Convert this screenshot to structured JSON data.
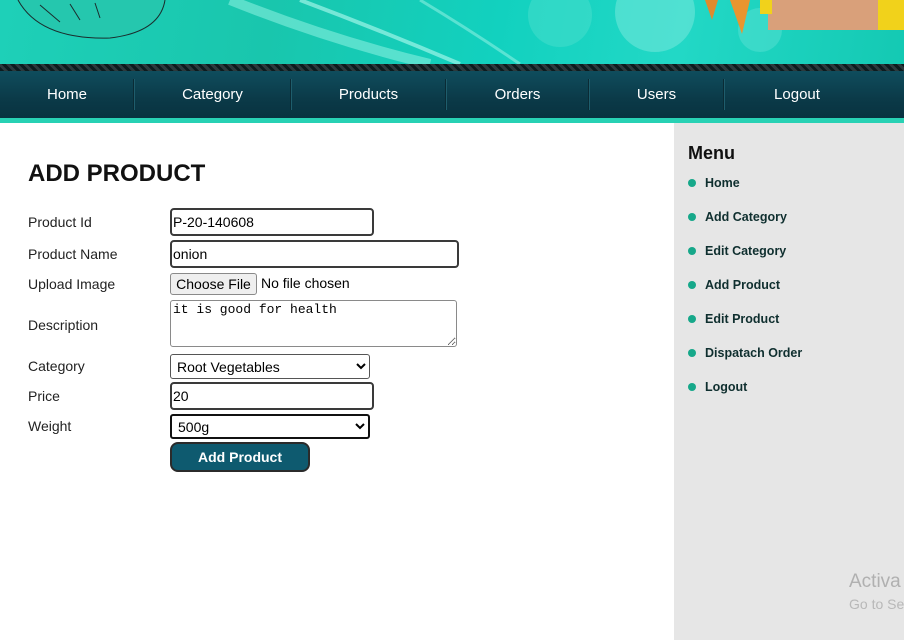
{
  "nav": {
    "items": [
      {
        "label": "Home"
      },
      {
        "label": "Category"
      },
      {
        "label": "Products"
      },
      {
        "label": "Orders"
      },
      {
        "label": "Users"
      },
      {
        "label": "Logout"
      }
    ]
  },
  "form": {
    "title": "ADD PRODUCT",
    "product_id_label": "Product Id",
    "product_id_value": "P-20-140608",
    "product_name_label": "Product Name",
    "product_name_value": "onion",
    "upload_label": "Upload Image",
    "choose_file_label": "Choose File",
    "no_file_text": "No file chosen",
    "description_label": "Description",
    "description_value": "it is good for health",
    "category_label": "Category",
    "category_value": "Root Vegetables",
    "price_label": "Price",
    "price_value": "20",
    "weight_label": "Weight",
    "weight_value": "500g",
    "submit_label": "Add Product"
  },
  "sidebar": {
    "title": "Menu",
    "items": [
      {
        "label": "Home"
      },
      {
        "label": "Add Category"
      },
      {
        "label": "Edit Category"
      },
      {
        "label": "Add Product"
      },
      {
        "label": "Edit Product"
      },
      {
        "label": "Dispatach Order"
      },
      {
        "label": "Logout"
      }
    ]
  },
  "watermark": {
    "line1": "Activa",
    "line2": "Go to Se"
  },
  "colors": {
    "nav_bg": "#0b3a48",
    "accent": "#28d1b4",
    "button_bg": "#0e5a6f",
    "sidebar_bg": "#e6e6e6",
    "bullet": "#16a88a"
  }
}
